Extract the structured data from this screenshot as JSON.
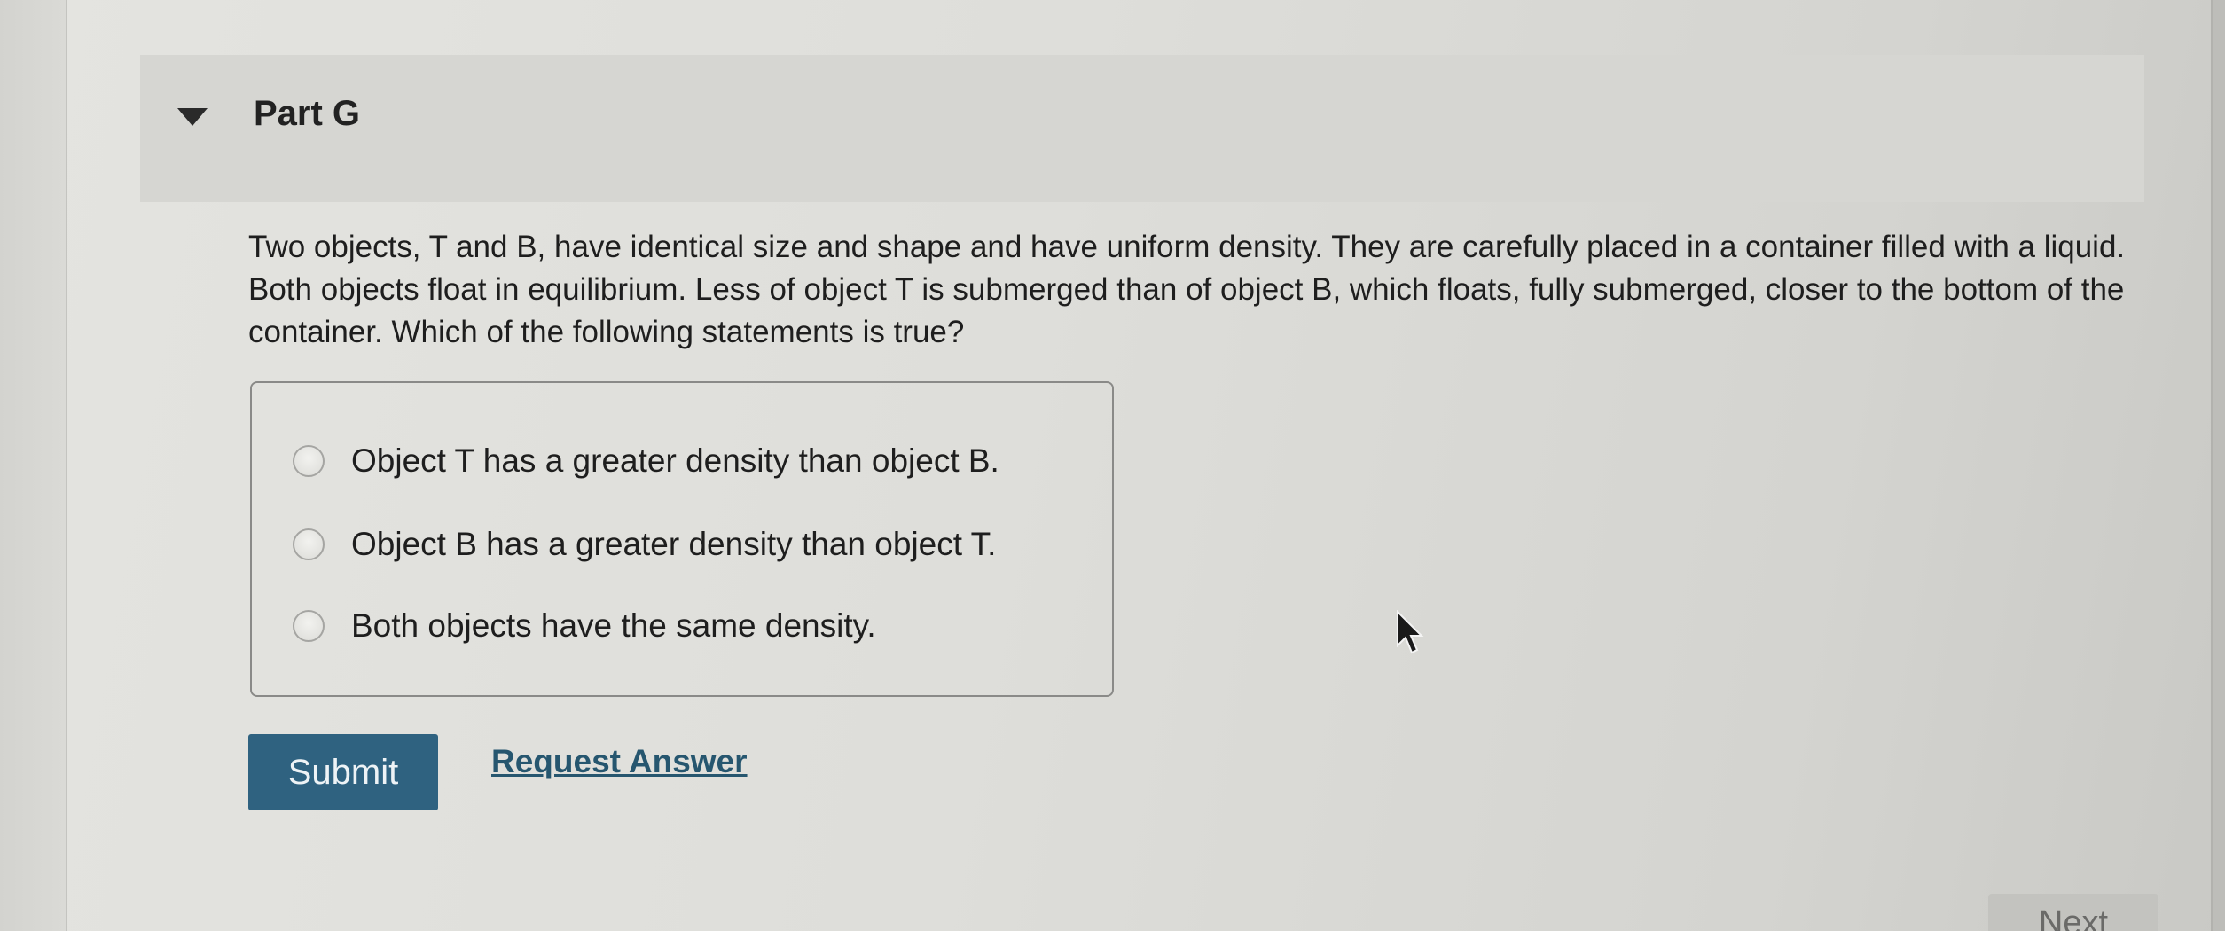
{
  "part": {
    "title": "Part G",
    "toggle_icon": "caret-down-icon"
  },
  "question": {
    "text": "Two objects, T and B, have identical size and shape and have uniform density. They are carefully placed in a container filled with a liquid. Both objects float in equilibrium. Less of object T is submerged than of object B, which floats, fully submerged, closer to the bottom of the container. Which of the following statements is true?"
  },
  "options": [
    {
      "label": "Object T has a greater density than object B.",
      "selected": false
    },
    {
      "label": "Object B has a greater density than object T.",
      "selected": false
    },
    {
      "label": "Both objects have the same density.",
      "selected": false
    }
  ],
  "actions": {
    "submit_label": "Submit",
    "request_answer_label": "Request Answer",
    "next_label": "Next"
  },
  "colors": {
    "submit_bg": "#2f6280",
    "link": "#26566f",
    "header_bg": "#d6d6d2"
  }
}
